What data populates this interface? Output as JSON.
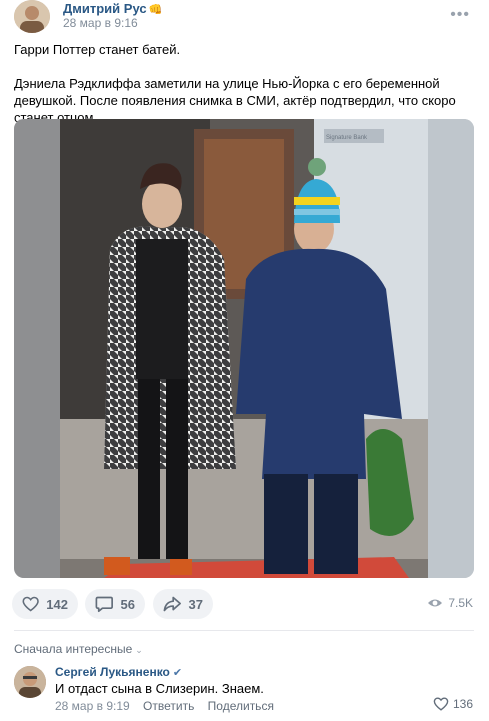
{
  "post": {
    "author": "Дмитрий Рус",
    "author_badge": "👊",
    "date": "28 мар в 9:16",
    "menu_icon": "more-dots-icon",
    "text_title": "Гарри Поттер станет батей.",
    "text_body": "Дэниела Рэдклиффа заметили на улице Нью-Йорка с его беременной девушкой. После появления снимка в СМИ, актёр подтвердил, что скоро станет отцом.",
    "photo_overlay": "Signature Bank"
  },
  "actions": {
    "likes": "142",
    "comments": "56",
    "shares": "37",
    "views": "7.5K"
  },
  "comments": {
    "sort_label": "Сначала интересные",
    "items": [
      {
        "author": "Сергей Лукьяненко",
        "text": "И отдаст сына в Слизерин. Знаем.",
        "date": "28 мар в 9:19",
        "reply_label": "Ответить",
        "share_label": "Поделиться",
        "likes": "136"
      }
    ]
  },
  "colors": {
    "link": "#2a5885",
    "meta": "#818c99",
    "button_bg": "#f0f2f5",
    "icon": "#626d7a"
  }
}
